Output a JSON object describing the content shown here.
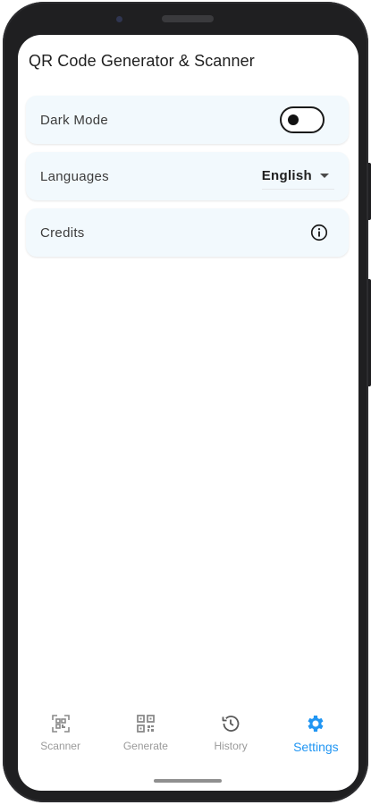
{
  "app": {
    "title": "QR Code Generator & Scanner"
  },
  "settings": [
    {
      "label": "Dark Mode",
      "control": "toggle",
      "enabled": false
    },
    {
      "label": "Languages",
      "control": "dropdown",
      "value": "English"
    },
    {
      "label": "Credits",
      "control": "info-icon"
    }
  ],
  "nav": {
    "items": [
      {
        "label": "Scanner",
        "icon": "qr-scan-icon",
        "active": false
      },
      {
        "label": "Generate",
        "icon": "qr-code-icon",
        "active": false
      },
      {
        "label": "History",
        "icon": "history-icon",
        "active": false
      },
      {
        "label": "Settings",
        "icon": "gear-icon",
        "active": true
      }
    ]
  },
  "colors": {
    "accent": "#2196f3",
    "card_background": "#f2f9fd",
    "inactive_nav": "#9a9a9a"
  }
}
